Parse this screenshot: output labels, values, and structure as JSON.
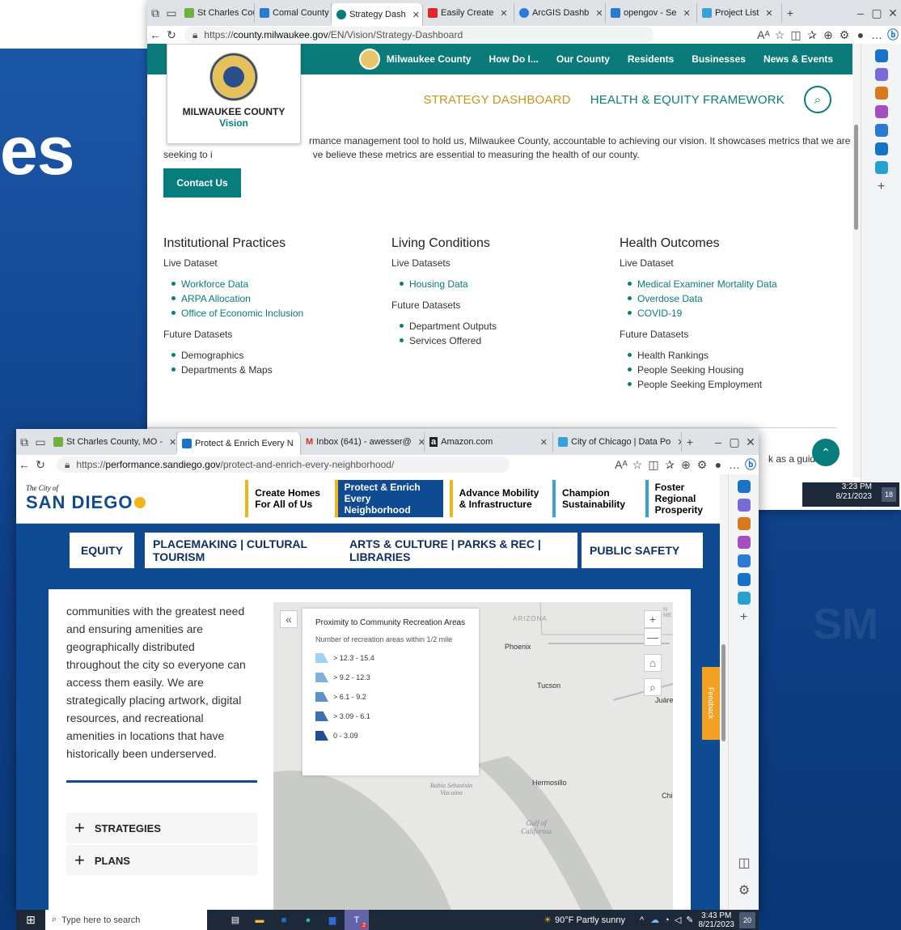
{
  "slide": {
    "title_fragment": "es",
    "ghost_text": "SM"
  },
  "browser1": {
    "tabs": [
      {
        "label": "St Charles Cou",
        "color": "#6fb040"
      },
      {
        "label": "Comal County",
        "color": "#2a7bd6"
      },
      {
        "label": "Strategy Dash",
        "color": "#0a7b79"
      },
      {
        "label": "Easily Create",
        "color": "#e3242b"
      },
      {
        "label": "ArcGIS Dashb",
        "color": "#2a7bd6"
      },
      {
        "label": "opengov - Se",
        "color": "#2a7bd6"
      },
      {
        "label": "Project List",
        "color": "#3aa0dc"
      }
    ],
    "url_prefix": "https://",
    "url_domain": "county.milwaukee.gov",
    "url_path": "/EN/Vision/Strategy-Dashboard",
    "zoom_ab": "Aᴬ",
    "nav": [
      "Milwaukee County",
      "How Do I...",
      "Our County",
      "Residents",
      "Businesses",
      "News & Events"
    ],
    "subnav": [
      "STRATEGY DASHBOARD",
      "HEALTH & EQUITY FRAMEWORK"
    ],
    "logo_title": "MILWAUKEE COUNTY",
    "logo_sub": "Vision",
    "intro_line1": "rmance management tool to hold us, Milwaukee County, accountable to achieving our vision. It showcases metrics that we are",
    "intro_line2a": "seeking to i",
    "intro_line2b": "ve believe these metrics are essential to measuring the health of our county.",
    "contact_label": "Contact Us",
    "columns": [
      {
        "title": "Institutional Practices",
        "live_label": "Live Dataset",
        "live": [
          "Workforce Data",
          "ARPA Allocation",
          "Office of Economic Inclusion"
        ],
        "future_label": "Future Datasets",
        "future": [
          "Demographics",
          "Departments & Maps"
        ]
      },
      {
        "title": "Living Conditions",
        "live_label": "Live Datasets",
        "live": [
          "Housing Data"
        ],
        "future_label": "Future Datasets",
        "future": [
          "Department Outputs",
          "Services Offered"
        ]
      },
      {
        "title": "Health Outcomes",
        "live_label": "Live Dataset",
        "live": [
          "Medical Examiner Mortality Data",
          "Overdose Data",
          "COVID-19"
        ],
        "future_label": "Future Datasets",
        "future": [
          "Health Rankings",
          "People Seeking Housing",
          "People Seeking Employment"
        ]
      }
    ],
    "partial_text": "k as a guide,",
    "clock_time": "3:23 PM",
    "clock_date": "8/21/2023",
    "notif_count": "18"
  },
  "browser2": {
    "tabs": [
      {
        "label": "St Charles County, MO -",
        "color": "#6fb040"
      },
      {
        "label": "Protect & Enrich Every N",
        "color": "#1a73c9"
      },
      {
        "label": "Inbox (641) - awesser@",
        "color": "#d93025"
      },
      {
        "label": "Amazon.com",
        "color": "#222222"
      },
      {
        "label": "City of Chicago | Data Po",
        "color": "#3aa0dc"
      }
    ],
    "url_prefix": "https://",
    "url_domain": "performance.sandiego.gov",
    "url_path": "/protect-and-enrich-every-neighborhood/",
    "logo_small": "The City of",
    "logo_big": "SAN DIEGO",
    "menu": [
      {
        "label": "Create Homes For All of Us",
        "color": "#f2b418",
        "active": false
      },
      {
        "label": "Protect & Enrich Every Neighborhood",
        "color": "#0e4b93",
        "active": true
      },
      {
        "label": "Advance Mobility & Infrastructure",
        "color": "#f2b418",
        "active": false
      },
      {
        "label": "Champion Sustainability",
        "color": "#3aa0dc",
        "active": false
      },
      {
        "label": "Foster Regional Prosperity",
        "color": "#3aa0dc",
        "active": false
      }
    ],
    "category_tabs": [
      "EQUITY",
      "PLACEMAKING | CULTURAL TOURISM",
      "ARTS & CULTURE | PARKS & REC | LIBRARIES",
      "PUBLIC SAFETY"
    ],
    "body_text": [
      "communities with the greatest need",
      "and ensuring amenities are",
      "geographically distributed",
      "throughout the city so everyone can",
      "access them easily. We are",
      "strategically placing artwork, digital",
      "resources, and recreational",
      "amenities in locations that have",
      "historically been underserved."
    ],
    "accordion": [
      "STRATEGIES",
      "PLANS"
    ],
    "map": {
      "legend_title": "Proximity to Community Recreation Areas",
      "legend_subtitle": "Number of recreation areas within 1/2 mile",
      "legend_items": [
        {
          "label": "> 12.3 - 15.4",
          "color": "#9fd3f0"
        },
        {
          "label": "> 9.2 - 12.3",
          "color": "#7fb3df"
        },
        {
          "label": "> 6.1 - 9.2",
          "color": "#5b92cb"
        },
        {
          "label": "> 3.09 - 6.1",
          "color": "#3c70b0"
        },
        {
          "label": "0 - 3.09",
          "color": "#1f4f91"
        }
      ],
      "places": [
        "ARIZONA",
        "Phoenix",
        "Tucson",
        "Juáre",
        "Hermosillo",
        "Chi",
        "Bahía Sebastián Vizcaíno",
        "Gulf of California",
        "N ME"
      ],
      "collapse_glyph": "«",
      "zoom_in": "+",
      "zoom_out": "—"
    },
    "feedback_label": "Feedback"
  },
  "taskbar": {
    "search_placeholder": "Type here to search",
    "weather": "90°F  Partly sunny",
    "time": "3:43 PM",
    "date": "8/21/2023",
    "notif_count": "20",
    "teams_badge": "2"
  }
}
